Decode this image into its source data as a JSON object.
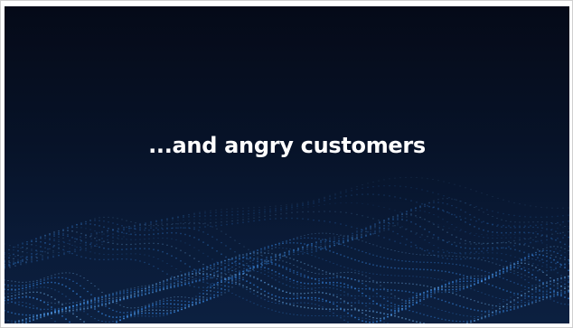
{
  "slide": {
    "headline": "...and angry customers",
    "background_top": "#050a18",
    "background_bottom": "#0c2040",
    "wave_color": "#3a8ff0",
    "wave_glow": "#7fc3ff"
  }
}
